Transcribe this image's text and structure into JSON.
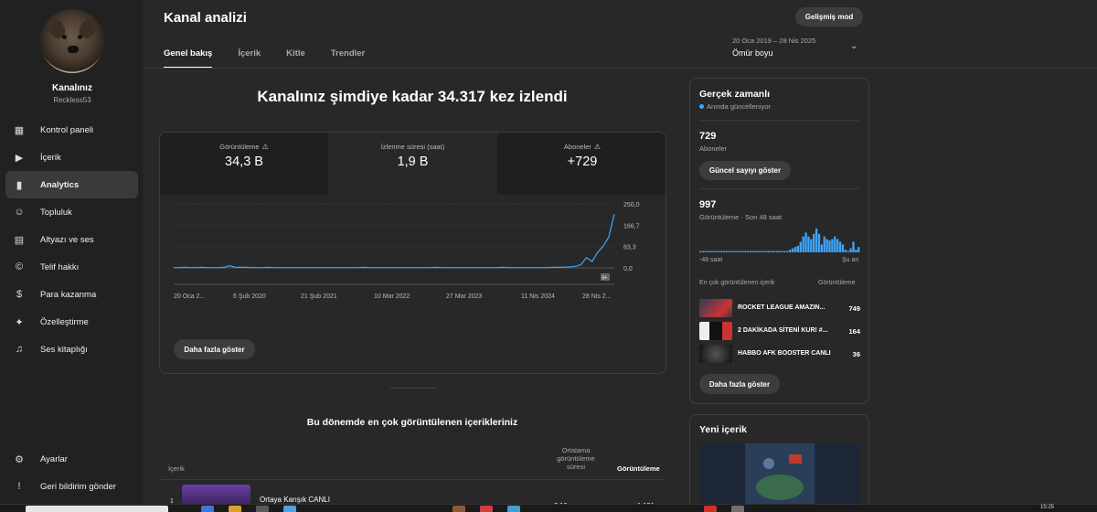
{
  "channel": {
    "name": "Kanalınız",
    "handle": "Reckless53"
  },
  "sidebar": {
    "items": [
      {
        "label": "Kontrol paneli",
        "icon": "dashboard-icon",
        "glyph": "▦"
      },
      {
        "label": "İçerik",
        "icon": "content-icon",
        "glyph": "▶"
      },
      {
        "label": "Analytics",
        "icon": "analytics-icon",
        "glyph": "▮",
        "active": true
      },
      {
        "label": "Topluluk",
        "icon": "community-icon",
        "glyph": "☺"
      },
      {
        "label": "Altyazı ve ses",
        "icon": "subtitles-icon",
        "glyph": "▤"
      },
      {
        "label": "Telif hakkı",
        "icon": "copyright-icon",
        "glyph": "©"
      },
      {
        "label": "Para kazanma",
        "icon": "monetization-icon",
        "glyph": "$"
      },
      {
        "label": "Özelleştirme",
        "icon": "customization-icon",
        "glyph": "✦"
      },
      {
        "label": "Ses kitaplığı",
        "icon": "audio-library-icon",
        "glyph": "♫"
      }
    ],
    "bottom_items": [
      {
        "label": "Ayarlar",
        "icon": "gear-icon",
        "glyph": "⚙"
      },
      {
        "label": "Geri bildirim gönder",
        "icon": "feedback-icon",
        "glyph": "!"
      }
    ]
  },
  "header": {
    "title": "Kanal analizi",
    "advanced_button": "Gelişmiş mod",
    "tabs": [
      "Genel bakış",
      "İçerik",
      "Kitle",
      "Trendler"
    ],
    "date_range": "20 Oca 2019 – 28 Nis 2025",
    "date_label": "Ömür boyu"
  },
  "headline": "Kanalınız şimdiye kadar 34.317 kez izlendi",
  "metrics": [
    {
      "label": "Görüntüleme",
      "value": "34,3 B",
      "warning": true
    },
    {
      "label": "İzlenme süresi (saat)",
      "value": "1,9 B",
      "warning": false
    },
    {
      "label": "Aboneler",
      "value": "+729",
      "warning": true
    }
  ],
  "chart_data": {
    "type": "line",
    "x_ticks": [
      "20 Oca 2...",
      "6 Şub 2020",
      "21 Şub 2021",
      "10 Mar 2022",
      "27 Mar 2023",
      "11 Nis 2024",
      "28 Nis 2..."
    ],
    "y_ticks": [
      "250,0",
      "166,7",
      "83,3",
      "0,0"
    ],
    "ylim": [
      0,
      250
    ],
    "series": [
      {
        "color": "#3ea6ff",
        "values": [
          1,
          1,
          2,
          1,
          1,
          2,
          1,
          1,
          1,
          2,
          8,
          3,
          2,
          2,
          1,
          1,
          1,
          2,
          1,
          1,
          1,
          1,
          1,
          1,
          1,
          1,
          1,
          1,
          1,
          1,
          1,
          1,
          1,
          1,
          2,
          1,
          1,
          1,
          1,
          1,
          1,
          1,
          1,
          1,
          1,
          1,
          1,
          2,
          1,
          1,
          1,
          1,
          1,
          1,
          1,
          1,
          1,
          1,
          1,
          2,
          1,
          1,
          1,
          1,
          1,
          1,
          1,
          1,
          2,
          2,
          3,
          4,
          6,
          12,
          40,
          25,
          60,
          85,
          120,
          210
        ]
      }
    ],
    "latest_badge": "5+",
    "show_more": "Daha fazla göster"
  },
  "top_content": {
    "title": "Bu dönemde en çok görüntülenen içerikleriniz",
    "col_content": "İçerik",
    "col_avg": "Ortalama görüntüleme süresi",
    "col_views": "Görüntüleme",
    "rows": [
      {
        "num": "1",
        "title": "Ortaya Karışık CANLI",
        "avg": "3:13",
        "views": "1.131"
      }
    ]
  },
  "realtime": {
    "title": "Gerçek zamanlı",
    "subtitle": "Anında güncelleniyor",
    "subscribers": "729",
    "subscribers_label": "Aboneler",
    "show_count": "Güncel sayıyı göster",
    "views": "997",
    "views_label": "Görüntüleme · Son 48 saat",
    "bars": [
      1,
      1,
      1,
      1,
      1,
      1,
      1,
      1,
      1,
      1,
      1,
      1,
      1,
      1,
      1,
      1,
      1,
      1,
      1,
      1,
      1,
      1,
      1,
      1,
      1,
      1,
      1,
      1,
      1,
      1,
      1,
      1,
      1,
      1,
      2,
      3,
      4,
      5,
      8,
      12,
      15,
      12,
      10,
      14,
      18,
      14,
      6,
      12,
      10,
      9,
      10,
      12,
      10,
      8,
      6,
      2,
      1,
      3,
      8,
      2,
      4
    ],
    "axis_left": "-48 saat",
    "axis_right": "Şu an",
    "list_head_left": "En çok görüntülenen içerik",
    "list_head_right": "Görüntüleme",
    "items": [
      {
        "title": "ROCKET LEAGUE AMAZIN...",
        "value": "749"
      },
      {
        "title": "2 DAKİKADA SİTENİ KUR! #...",
        "value": "164"
      },
      {
        "title": "HABBO AFK BOOSTER CANLI",
        "value": "36"
      }
    ],
    "more": "Daha fazla göster"
  },
  "new_content": {
    "title": "Yeni içerik"
  },
  "taskbar": {
    "time": "15:25"
  }
}
